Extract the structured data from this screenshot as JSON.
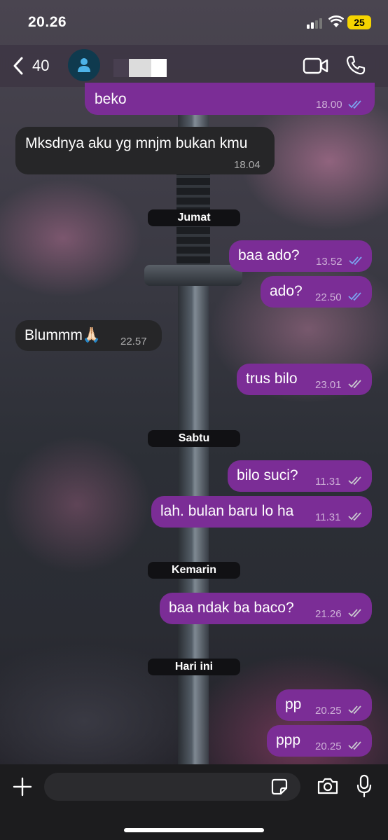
{
  "status_bar": {
    "time": "20.26",
    "battery": "25"
  },
  "header": {
    "back_count": "40"
  },
  "messages": [
    {
      "text": "beko",
      "time": "18.00",
      "dir": "out",
      "ticks": "read"
    },
    {
      "text": "Mksdnya aku yg mnjm bukan kmu",
      "time": "18.04",
      "dir": "in"
    },
    {
      "day": "Jumat"
    },
    {
      "text": "baa ado?",
      "time": "13.52",
      "dir": "out",
      "ticks": "read"
    },
    {
      "text": "ado?",
      "time": "22.50",
      "dir": "out",
      "ticks": "read"
    },
    {
      "text": "Blummm🙏🏻",
      "time": "22.57",
      "dir": "in"
    },
    {
      "text": "trus bilo",
      "time": "23.01",
      "dir": "out",
      "ticks": "delivered"
    },
    {
      "day": "Sabtu"
    },
    {
      "text": "bilo suci?",
      "time": "11.31",
      "dir": "out",
      "ticks": "delivered"
    },
    {
      "text": "lah. bulan baru lo ha",
      "time": "11.31",
      "dir": "out",
      "ticks": "delivered"
    },
    {
      "day": "Kemarin"
    },
    {
      "text": "baa ndak ba baco?",
      "time": "21.26",
      "dir": "out",
      "ticks": "delivered"
    },
    {
      "day": "Hari ini"
    },
    {
      "text": "pp",
      "time": "20.25",
      "dir": "out",
      "ticks": "delivered"
    },
    {
      "text": "ppp",
      "time": "20.25",
      "dir": "out",
      "ticks": "delivered"
    }
  ],
  "composer": {
    "placeholder": ""
  },
  "colors": {
    "outgoing_bubble": "#7b2d96",
    "incoming_bubble": "#262628",
    "read_tick": "#7ba4f0",
    "delivered_tick": "#c9c9cf",
    "battery": "#f5d400"
  },
  "icons": [
    "back-chevron-icon",
    "person-icon",
    "video-call-icon",
    "phone-icon",
    "plus-icon",
    "sticker-icon",
    "camera-icon",
    "microphone-icon"
  ]
}
